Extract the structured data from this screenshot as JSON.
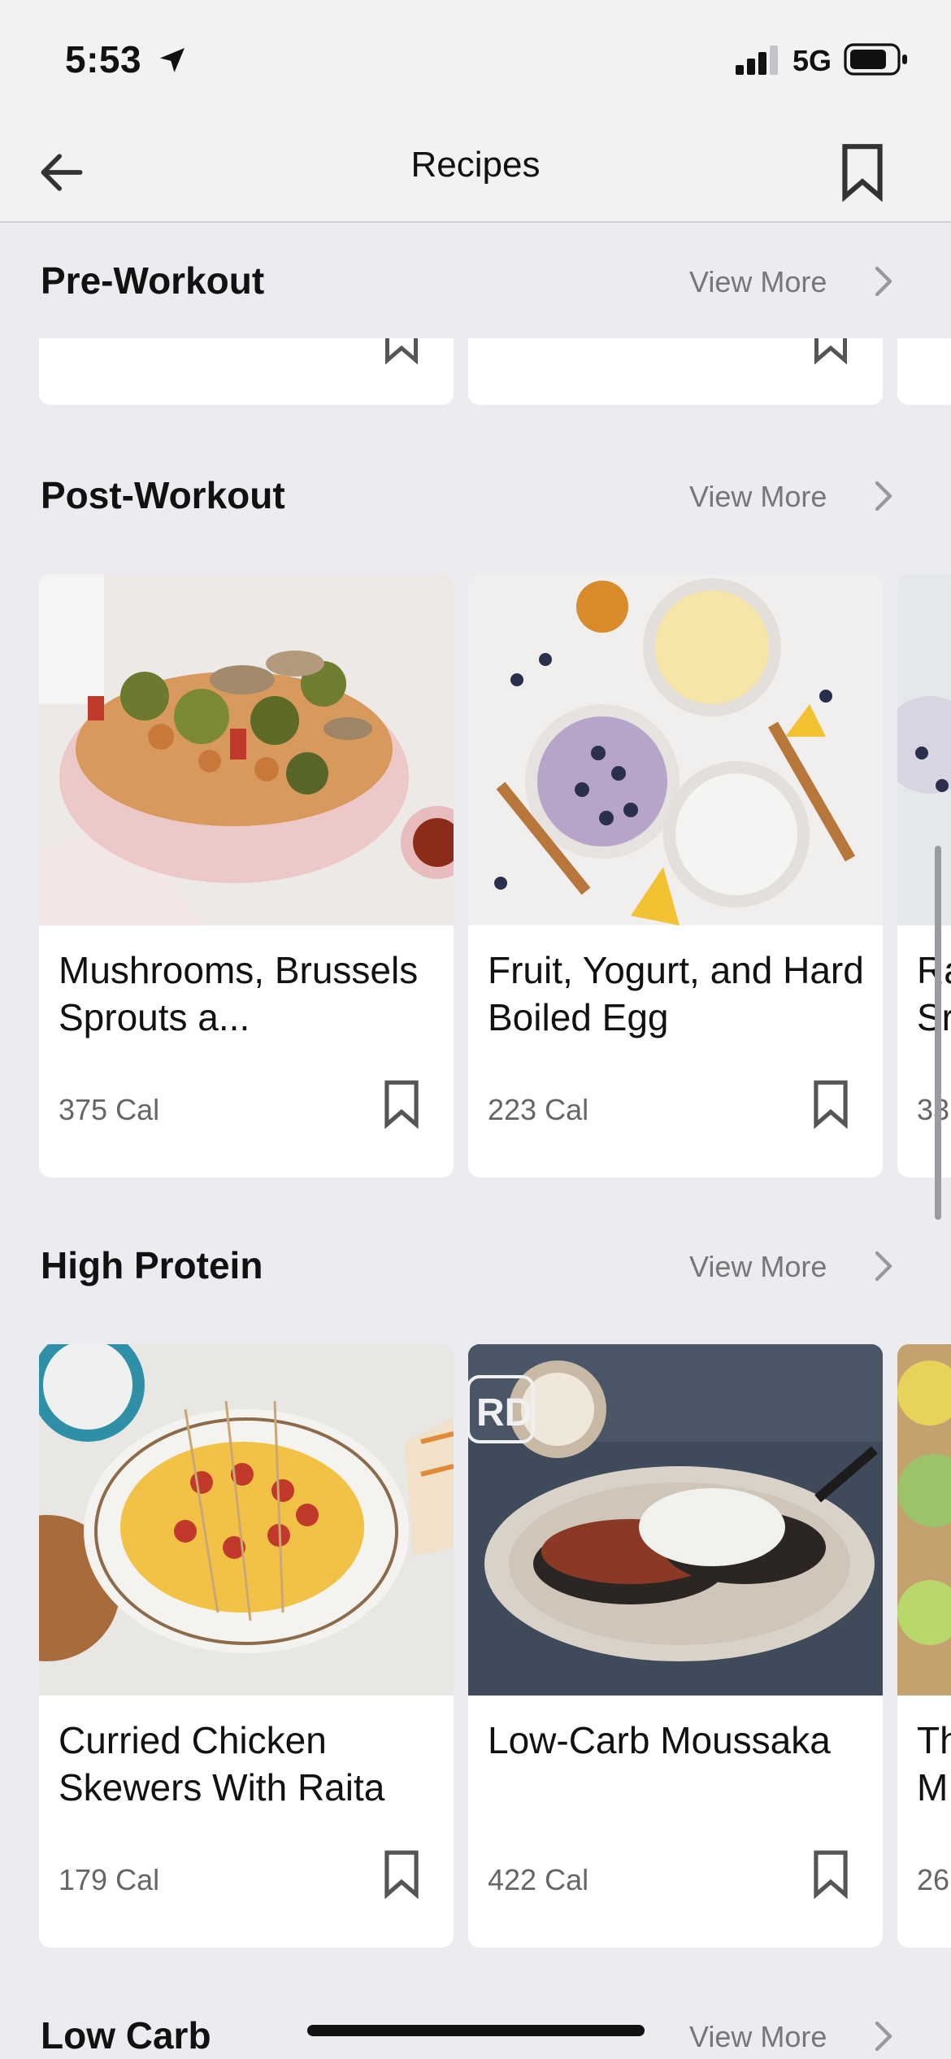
{
  "status_bar": {
    "time": "5:53",
    "network": "5G"
  },
  "nav": {
    "title": "Recipes"
  },
  "sections": [
    {
      "title": "Pre-Workout",
      "view_more": "View More"
    },
    {
      "title": "Post-Workout",
      "view_more": "View More",
      "cards": [
        {
          "title": "Mushrooms, Brussels Sprouts a...",
          "calories": "375 Cal"
        },
        {
          "title": "Fruit, Yogurt, and Hard Boiled Egg",
          "calories": "223 Cal"
        },
        {
          "title": "Ra Sr",
          "calories": "33"
        }
      ]
    },
    {
      "title": "High Protein",
      "view_more": "View More",
      "cards": [
        {
          "title": "Curried Chicken Skewers With Raita",
          "calories": "179 Cal"
        },
        {
          "title": "Low-Carb Moussaka",
          "calories": "422 Cal"
        },
        {
          "title": "Th M",
          "calories": "26"
        }
      ]
    },
    {
      "title": "Low Carb",
      "view_more": "View More"
    }
  ],
  "icons": {
    "back": "arrow-left-icon",
    "bookmark": "bookmark-icon",
    "chevron": "chevron-right-icon"
  },
  "colors": {
    "background": "#ebebf0",
    "header": "#f2f2f5",
    "secondary_text": "#777777"
  }
}
